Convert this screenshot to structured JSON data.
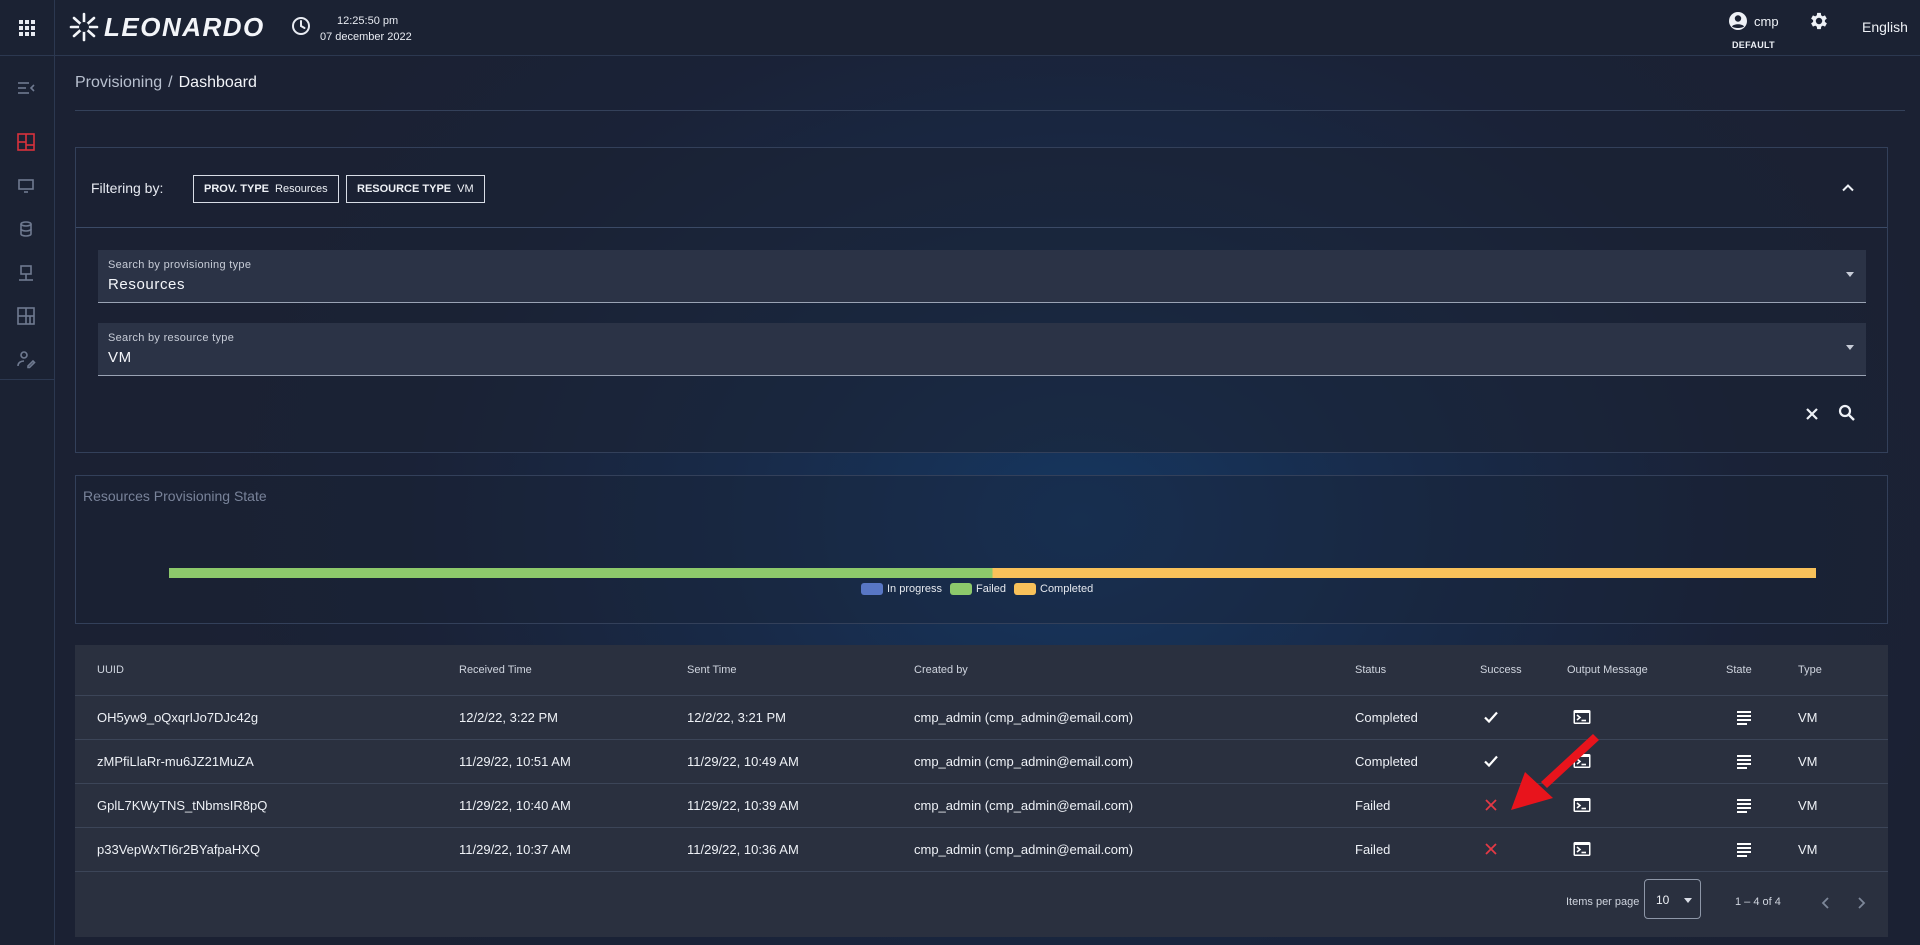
{
  "topbar": {
    "apps_icon": "apps-grid-icon",
    "logo_text": "LEONARDO",
    "time": "12:25:50 pm",
    "date": "07 december 2022",
    "user_name": "cmp",
    "user_role": "DEFAULT",
    "settings_icon": "gear-icon",
    "language": "English"
  },
  "sidebar": {
    "items": [
      {
        "name": "collapse-menu-icon",
        "active": false
      },
      {
        "name": "dashboard-icon",
        "active": true
      },
      {
        "name": "monitor-icon",
        "active": false
      },
      {
        "name": "database-icon",
        "active": false
      },
      {
        "name": "workstation-icon",
        "active": false
      },
      {
        "name": "layout-icon",
        "active": false
      },
      {
        "name": "user-settings-icon",
        "active": false
      }
    ]
  },
  "breadcrumb": {
    "parent": "Provisioning",
    "separator": "/",
    "current": "Dashboard"
  },
  "filter": {
    "label": "Filtering by:",
    "chips": [
      {
        "key": "PROV. TYPE",
        "value": "Resources"
      },
      {
        "key": "RESOURCE TYPE",
        "value": "VM"
      }
    ],
    "provisioning_field": {
      "label": "Search by provisioning type",
      "value": "Resources"
    },
    "resource_field": {
      "label": "Search by resource type",
      "value": "VM"
    }
  },
  "chart_data": {
    "type": "bar",
    "orientation": "horizontal",
    "stacked": true,
    "title": "Resources Provisioning State",
    "categories": [
      ""
    ],
    "series": [
      {
        "name": "In progress",
        "values": [
          0
        ],
        "color": "#5876c4"
      },
      {
        "name": "Failed",
        "values": [
          2
        ],
        "color": "#8dc96b"
      },
      {
        "name": "Completed",
        "values": [
          2
        ],
        "color": "#f8c15a"
      }
    ],
    "legend": "bottom"
  },
  "table": {
    "headers": [
      "UUID",
      "Received Time",
      "Sent Time",
      "Created by",
      "Status",
      "Success",
      "Output Message",
      "State",
      "Type"
    ],
    "rows": [
      {
        "uuid": "OH5yw9_oQxqrIJo7DJc42g",
        "received": "12/2/22, 3:22 PM",
        "sent": "12/2/22, 3:21 PM",
        "created_by": "cmp_admin (cmp_admin@email.com)",
        "status": "Completed",
        "success": true,
        "type": "VM"
      },
      {
        "uuid": "zMPfiLlaRr-mu6JZ21MuZA",
        "received": "11/29/22, 10:51 AM",
        "sent": "11/29/22, 10:49 AM",
        "created_by": "cmp_admin (cmp_admin@email.com)",
        "status": "Completed",
        "success": true,
        "type": "VM"
      },
      {
        "uuid": "GplL7KWyTNS_tNbmsIR8pQ",
        "received": "11/29/22, 10:40 AM",
        "sent": "11/29/22, 10:39 AM",
        "created_by": "cmp_admin (cmp_admin@email.com)",
        "status": "Failed",
        "success": false,
        "type": "VM"
      },
      {
        "uuid": "p33VepWxTI6r2BYafpaHXQ",
        "received": "11/29/22, 10:37 AM",
        "sent": "11/29/22, 10:36 AM",
        "created_by": "cmp_admin (cmp_admin@email.com)",
        "status": "Failed",
        "success": false,
        "type": "VM"
      }
    ],
    "icons": {
      "output": "terminal-icon",
      "state": "list-lines-icon",
      "success": "check-icon",
      "fail": "cross-icon"
    },
    "colors": {
      "fail": "#e53945",
      "success": "#ffffff"
    }
  },
  "pagination": {
    "items_per_page_label": "Items per page",
    "items_per_page": "10",
    "range": "1 – 4 of 4"
  },
  "annotation": {
    "icon": "red-arrow-icon",
    "color": "#e8141c"
  }
}
